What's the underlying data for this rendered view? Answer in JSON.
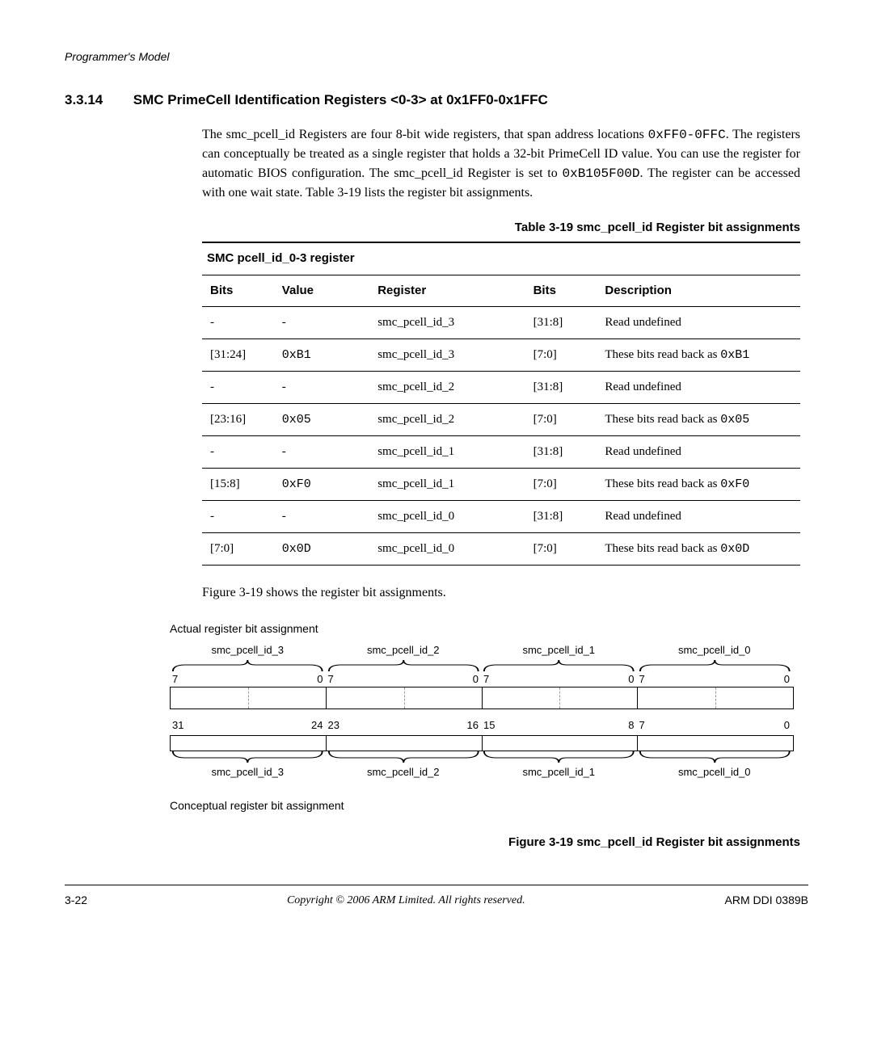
{
  "header": {
    "running_head": "Programmer's Model"
  },
  "section": {
    "number": "3.3.14",
    "title": "SMC PrimeCell Identification Registers <0-3> at 0x1FF0-0x1FFC"
  },
  "paragraph": {
    "p1a": "The smc_pcell_id Registers are four 8-bit wide registers, that span address locations ",
    "p1_code": "0xFF0-0FFC",
    "p1b": ". The registers can conceptually be treated as a single register that holds a 32-bit PrimeCell ID value. You can use the register for automatic BIOS configuration. The smc_pcell_id Register is set to ",
    "p1_code2": "0xB105F00D",
    "p1c": ". The register can be accessed with one wait state. Table 3-19 lists the register bit assignments."
  },
  "table": {
    "caption": "Table 3-19 smc_pcell_id Register bit assignments",
    "title": "SMC pcell_id_0-3 register",
    "headers": {
      "bits_a": "Bits",
      "value": "Value",
      "register": "Register",
      "bits_b": "Bits",
      "description": "Description"
    },
    "rows": [
      {
        "bits_a": "-",
        "value": "-",
        "register": "smc_pcell_id_3",
        "bits_b": "[31:8]",
        "desc_a": "Read undefined",
        "code": "",
        "desc_b": ""
      },
      {
        "bits_a": "[31:24]",
        "value": "0xB1",
        "register": "smc_pcell_id_3",
        "bits_b": "[7:0]",
        "desc_a": "These bits read back as ",
        "code": "0xB1",
        "desc_b": ""
      },
      {
        "bits_a": "-",
        "value": "-",
        "register": "smc_pcell_id_2",
        "bits_b": "[31:8]",
        "desc_a": "Read undefined",
        "code": "",
        "desc_b": ""
      },
      {
        "bits_a": "[23:16]",
        "value": "0x05",
        "register": "smc_pcell_id_2",
        "bits_b": "[7:0]",
        "desc_a": "These bits read back as ",
        "code": "0x05",
        "desc_b": ""
      },
      {
        "bits_a": "-",
        "value": "-",
        "register": "smc_pcell_id_1",
        "bits_b": "[31:8]",
        "desc_a": "Read undefined",
        "code": "",
        "desc_b": ""
      },
      {
        "bits_a": "[15:8]",
        "value": "0xF0",
        "register": "smc_pcell_id_1",
        "bits_b": "[7:0]",
        "desc_a": "These bits read back as ",
        "code": "0xF0",
        "desc_b": ""
      },
      {
        "bits_a": "-",
        "value": "-",
        "register": "smc_pcell_id_0",
        "bits_b": "[31:8]",
        "desc_a": "Read undefined",
        "code": "",
        "desc_b": ""
      },
      {
        "bits_a": "[7:0]",
        "value": "0x0D",
        "register": "smc_pcell_id_0",
        "bits_b": "[7:0]",
        "desc_a": "These bits read back as ",
        "code": "0x0D",
        "desc_b": ""
      }
    ]
  },
  "after_table": "Figure 3-19 shows the register bit assignments.",
  "diagram": {
    "top_label": "Actual register bit assignment",
    "top_names": [
      "smc_pcell_id_3",
      "smc_pcell_id_2",
      "smc_pcell_id_1",
      "smc_pcell_id_0"
    ],
    "top_bits": [
      {
        "l": "7",
        "r": "0"
      },
      {
        "l": "7",
        "r": "0"
      },
      {
        "l": "7",
        "r": "0"
      },
      {
        "l": "7",
        "r": "0"
      }
    ],
    "bottom_bits": [
      {
        "l": "31",
        "r": "24"
      },
      {
        "l": "23",
        "r": "16"
      },
      {
        "l": "15",
        "r": "8"
      },
      {
        "l": "7",
        "r": "0"
      }
    ],
    "bottom_names": [
      "smc_pcell_id_3",
      "smc_pcell_id_2",
      "smc_pcell_id_1",
      "smc_pcell_id_0"
    ],
    "bottom_label": "Conceptual register bit assignment"
  },
  "figure_caption": "Figure 3-19 smc_pcell_id Register bit assignments",
  "footer": {
    "left": "3-22",
    "center": "Copyright © 2006 ARM Limited. All rights reserved.",
    "right": "ARM DDI 0389B"
  }
}
